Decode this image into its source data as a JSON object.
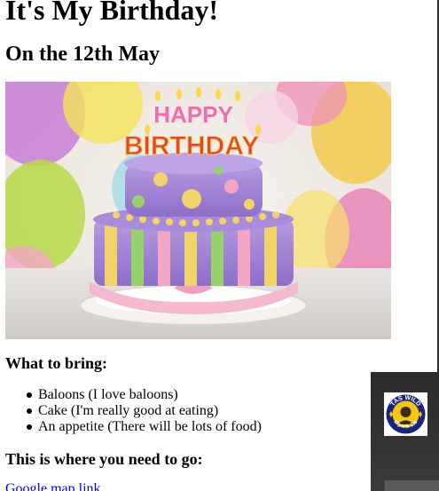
{
  "page": {
    "title": "It's My Birthday!",
    "subtitle": "On the 12th May"
  },
  "photo": {
    "cake_topper_line1": "HAPPY",
    "cake_topper_line2": "BIRTHDAY"
  },
  "bring": {
    "heading": "What to bring:",
    "items": [
      "Baloons (I love baloons)",
      "Cake (I'm really good at eating)",
      "An appetite (There will be lots of food)"
    ]
  },
  "directions": {
    "heading": "This is where you need to go:",
    "link_text": "Google map link"
  },
  "widget": {
    "badge_top_text": "TAS WILD",
    "badge_bottom_text": "Dipank Stc"
  },
  "colors": {
    "text": "#000000",
    "link": "#0000ee",
    "widget_bg": "#2b2b2b",
    "widget_tab": "#5a5a5a",
    "badge_ring": "#1a237e",
    "badge_star": "#f5c518"
  }
}
